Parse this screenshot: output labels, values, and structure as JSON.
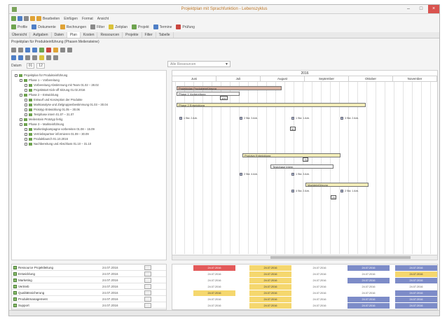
{
  "window": {
    "title": "Projektplan mit Sprachfunktion - Lebenszyklus",
    "minimize": "–",
    "maximize": "□",
    "close": "×"
  },
  "toolbar": {
    "row1_items": [
      "Bearbeiten",
      "Einfügen",
      "Format",
      "Ansicht"
    ],
    "row2_items": [
      "Profile",
      "Dokumente",
      "Rechnungen",
      "Filter",
      "Zeitplan",
      "Projekt",
      "Termine",
      "Prüfung"
    ]
  },
  "tabs": [
    "Übersicht",
    "Aufgaben",
    "Daten",
    "Plan",
    "Kosten",
    "Ressourcen",
    "Projekte",
    "Filter",
    "Tabelle"
  ],
  "subtitle": "Projektplan für Produkteinführung (Phasen Meilensteine)",
  "filter": {
    "label": "Datum",
    "value_from": "01",
    "value_to": "12",
    "combo_placeholder": "Alle Ressourcen"
  },
  "tree": {
    "items": [
      {
        "label": "Projektplan für Produkteinführung",
        "indent": 0
      },
      {
        "label": "Phase 1 – Vorbereitung",
        "indent": 1
      },
      {
        "label": "Vorbereitung Abstimmung mit Team 01.02 – 28.02",
        "indent": 2
      },
      {
        "label": "Projektstart Kick-off Sitzung 01.02.2016",
        "indent": 2
      },
      {
        "label": "Phase 2 – Entwicklung",
        "indent": 1
      },
      {
        "label": "Entwurf und Konzeption der Produkte",
        "indent": 2
      },
      {
        "label": "Marktanalyse und Zielgruppenbestimmung 01.03 – 30.04",
        "indent": 2
      },
      {
        "label": "Prototyp Entwicklung 01.05 – 30.06",
        "indent": 2
      },
      {
        "label": "Testphase intern 01.07 – 31.07",
        "indent": 2
      },
      {
        "label": "Meilenstein Prototyp fertig",
        "indent": 1
      },
      {
        "label": "Phase 3 – Markteinführung",
        "indent": 1
      },
      {
        "label": "Marketingkampagne vorbereiten 01.08 – 15.09",
        "indent": 2
      },
      {
        "label": "Vertriebspartner informieren 01.09 – 30.09",
        "indent": 2
      },
      {
        "label": "Produktlaunch 01.10.2016",
        "indent": 2
      },
      {
        "label": "Nachbereitung und Abschluss 01.10 – 31.10",
        "indent": 2
      }
    ]
  },
  "gantt": {
    "year": "2016",
    "months": [
      "Juni",
      "Juli",
      "August",
      "September",
      "Oktober",
      "November"
    ],
    "bars": [
      {
        "label": "Projektplan Produkteinführung",
        "style": "red"
      },
      {
        "label": "Phase 1 Vorbereitung",
        "style": "wht"
      },
      {
        "label": "Phase 2 Entwicklung",
        "style": "yel"
      },
      {
        "label": "Prototyp Entwicklung",
        "style": "yel"
      },
      {
        "label": "Testphase intern",
        "style": "wht"
      },
      {
        "label": "Markteinführung",
        "style": "yel"
      }
    ],
    "tags": [
      "100",
      "50",
      "75",
      "25"
    ],
    "nodes": [
      "1 Std. 2 Arb.",
      "2 Std. 3 Arb.",
      "1 Std. 1 Arb.",
      "3 Std. 2 Arb.",
      "2 Std. 4 Arb.",
      "1 Std. 3 Arb.",
      "4 Std. 2 Arb.",
      "2 Std. 1 Arb."
    ]
  },
  "resources": [
    {
      "name": "Ressource Projektleitung",
      "date": "24.07.2016"
    },
    {
      "name": "Entwicklung",
      "date": "24.07.2016"
    },
    {
      "name": "Marketing",
      "date": "24.07.2016"
    },
    {
      "name": "Vertrieb",
      "date": "24.07.2016"
    },
    {
      "name": "Qualitätssicherung",
      "date": "24.07.2016"
    },
    {
      "name": "Produktmanagement",
      "date": "24.07.2016"
    },
    {
      "name": "Support",
      "date": "24.07.2016"
    }
  ],
  "resource_cells": [
    [
      "24.07.2016",
      "24.07.2016",
      "24.07.2016",
      "24.07.2016",
      "24.07.2016"
    ],
    [
      "24.07.2016",
      "24.07.2016",
      "24.07.2016",
      "24.07.2016",
      "24.07.2016"
    ],
    [
      "24.07.2016",
      "24.07.2016",
      "24.07.2016",
      "24.07.2016",
      "24.07.2016"
    ],
    [
      "24.07.2016",
      "24.07.2016",
      "24.07.2016",
      "24.07.2016",
      "24.07.2016"
    ],
    [
      "24.07.2016",
      "24.07.2016",
      "24.07.2016",
      "24.07.2016",
      "24.07.2016"
    ],
    [
      "24.07.2016",
      "24.07.2016",
      "24.07.2016",
      "24.07.2016",
      "24.07.2016"
    ],
    [
      "24.07.2016",
      "24.07.2016",
      "24.07.2016",
      "24.07.2016",
      "24.07.2016"
    ]
  ],
  "colors": {
    "overload": "#e35a5a",
    "partial": "#f5d76e",
    "full": "#7d8cc8",
    "title_accent": "#c07a2a"
  }
}
